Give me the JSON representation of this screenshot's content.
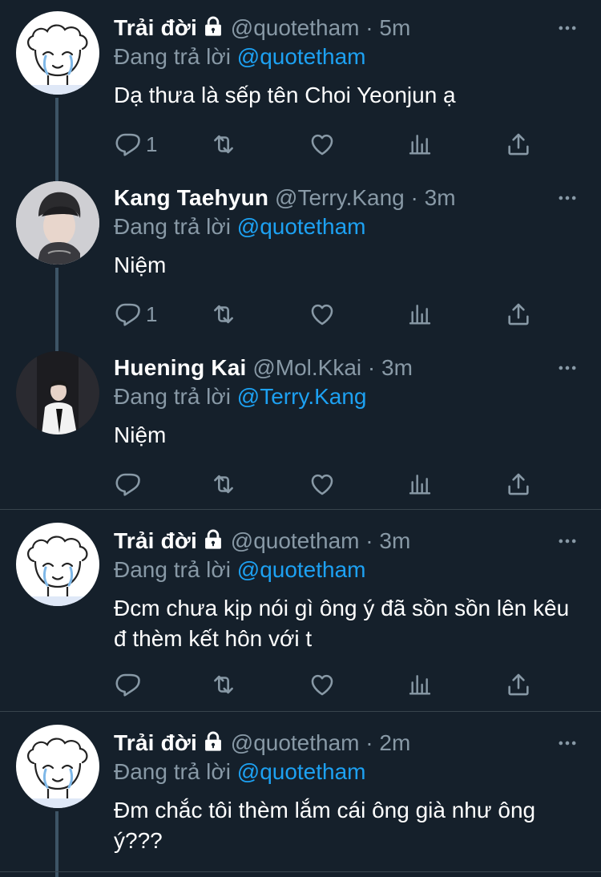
{
  "replying_label": "Đang trả lời",
  "tweets": [
    {
      "name": "Trải đời",
      "handle": "@quotetham",
      "separator": "·",
      "time": "5m",
      "locked": true,
      "reply_to": "@quotetham",
      "text": "Dạ thưa là sếp tên Choi Yeonjun ạ",
      "reply_count": "1",
      "avatar": "chef-drawing-avatar"
    },
    {
      "name": "Kang Taehyun",
      "handle": "@Terry.Kang",
      "separator": "·",
      "time": "3m",
      "locked": false,
      "reply_to": "@quotetham",
      "text": "Niệm",
      "reply_count": "1",
      "avatar": "photo-avatar-dark-hair"
    },
    {
      "name": "Huening Kai",
      "handle": "@Mol.Kkai",
      "separator": "·",
      "time": "3m",
      "locked": false,
      "reply_to": "@Terry.Kang",
      "text": "Niệm",
      "reply_count": "",
      "avatar": "photo-avatar-white-suit"
    },
    {
      "name": "Trải đời",
      "handle": "@quotetham",
      "separator": "·",
      "time": "3m",
      "locked": true,
      "reply_to": "@quotetham",
      "text": "Đcm chưa kịp nói gì ông ý đã sồn sồn lên kêu đ thèm kết hôn với t",
      "reply_count": "",
      "avatar": "chef-drawing-avatar"
    },
    {
      "name": "Trải đời",
      "handle": "@quotetham",
      "separator": "·",
      "time": "2m",
      "locked": true,
      "reply_to": "@quotetham",
      "text": "Đm chắc tôi thèm lắm cái ông già như ông ý???",
      "reply_count": "",
      "avatar": "chef-drawing-avatar"
    }
  ],
  "colors": {
    "background": "#15202b",
    "text_secondary": "#8899a6",
    "link": "#1da1f2",
    "divider": "#38444d"
  }
}
